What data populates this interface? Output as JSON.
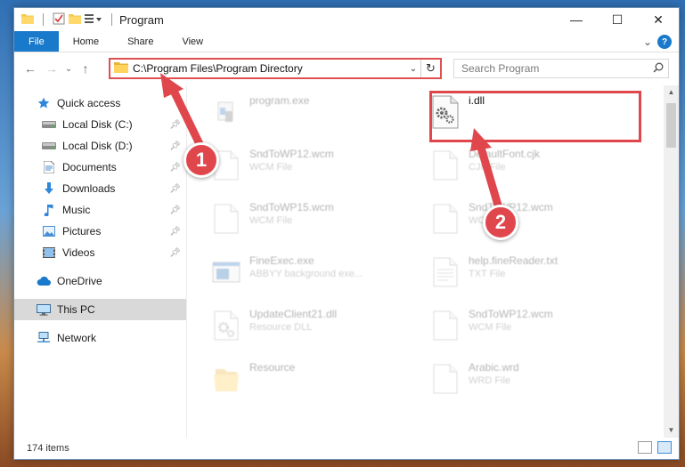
{
  "window": {
    "title": "Program",
    "controls": {
      "minimize": "—",
      "maximize": "☐",
      "close": "✕"
    }
  },
  "ribbon": {
    "tabs": [
      "File",
      "Home",
      "Share",
      "View"
    ],
    "expand": "⌄",
    "help": "?"
  },
  "nav": {
    "back": "←",
    "forward": "→",
    "recent": "⌄",
    "up": "↑"
  },
  "address": {
    "path": "C:\\Program Files\\Program Directory",
    "dropdown": "⌄",
    "refresh": "↻"
  },
  "search": {
    "placeholder": "Search Program"
  },
  "sidebar": {
    "quick_access": {
      "label": "Quick access",
      "items": [
        {
          "label": "Local Disk (C:)",
          "icon": "drive-icon"
        },
        {
          "label": "Local Disk (D:)",
          "icon": "drive-icon"
        },
        {
          "label": "Documents",
          "icon": "documents-icon"
        },
        {
          "label": "Downloads",
          "icon": "downloads-icon"
        },
        {
          "label": "Music",
          "icon": "music-icon"
        },
        {
          "label": "Pictures",
          "icon": "pictures-icon"
        },
        {
          "label": "Videos",
          "icon": "videos-icon"
        }
      ]
    },
    "onedrive": "OneDrive",
    "this_pc": "This PC",
    "network": "Network"
  },
  "files": [
    {
      "name": "program.exe",
      "type": "",
      "icon": "exe-icon"
    },
    {
      "name": "i.dll",
      "type": "",
      "icon": "dll-gear-icon"
    },
    {
      "name": "SndToWP12.wcm",
      "type": "WCM File",
      "icon": "blank-file-icon"
    },
    {
      "name": "DefaultFont.cjk",
      "type": "CJK File",
      "icon": "blank-file-icon"
    },
    {
      "name": "SndToWP15.wcm",
      "type": "WCM File",
      "icon": "blank-file-icon"
    },
    {
      "name": "SndToWP12.wcm",
      "type": "WCM File",
      "icon": "blank-file-icon"
    },
    {
      "name": "FineExec.exe",
      "type": "ABBYY background exe...",
      "icon": "window-exe-icon"
    },
    {
      "name": "help.fineReader.txt",
      "type": "TXT File",
      "icon": "text-file-icon"
    },
    {
      "name": "UpdateClient21.dll",
      "type": "Resource DLL",
      "icon": "dll-gear-icon"
    },
    {
      "name": "SndToWP12.wcm",
      "type": "WCM File",
      "icon": "blank-file-icon"
    },
    {
      "name": "Resource",
      "type": "",
      "icon": "folder-icon"
    },
    {
      "name": "Arabic.wrd",
      "type": "WRD File",
      "icon": "blank-file-icon"
    }
  ],
  "status": {
    "count": "174 items"
  },
  "annotations": {
    "step1": "1",
    "step2": "2"
  },
  "colors": {
    "accent": "#1979ca",
    "annotation": "#e0474d",
    "selected": "#d9d9d9"
  }
}
